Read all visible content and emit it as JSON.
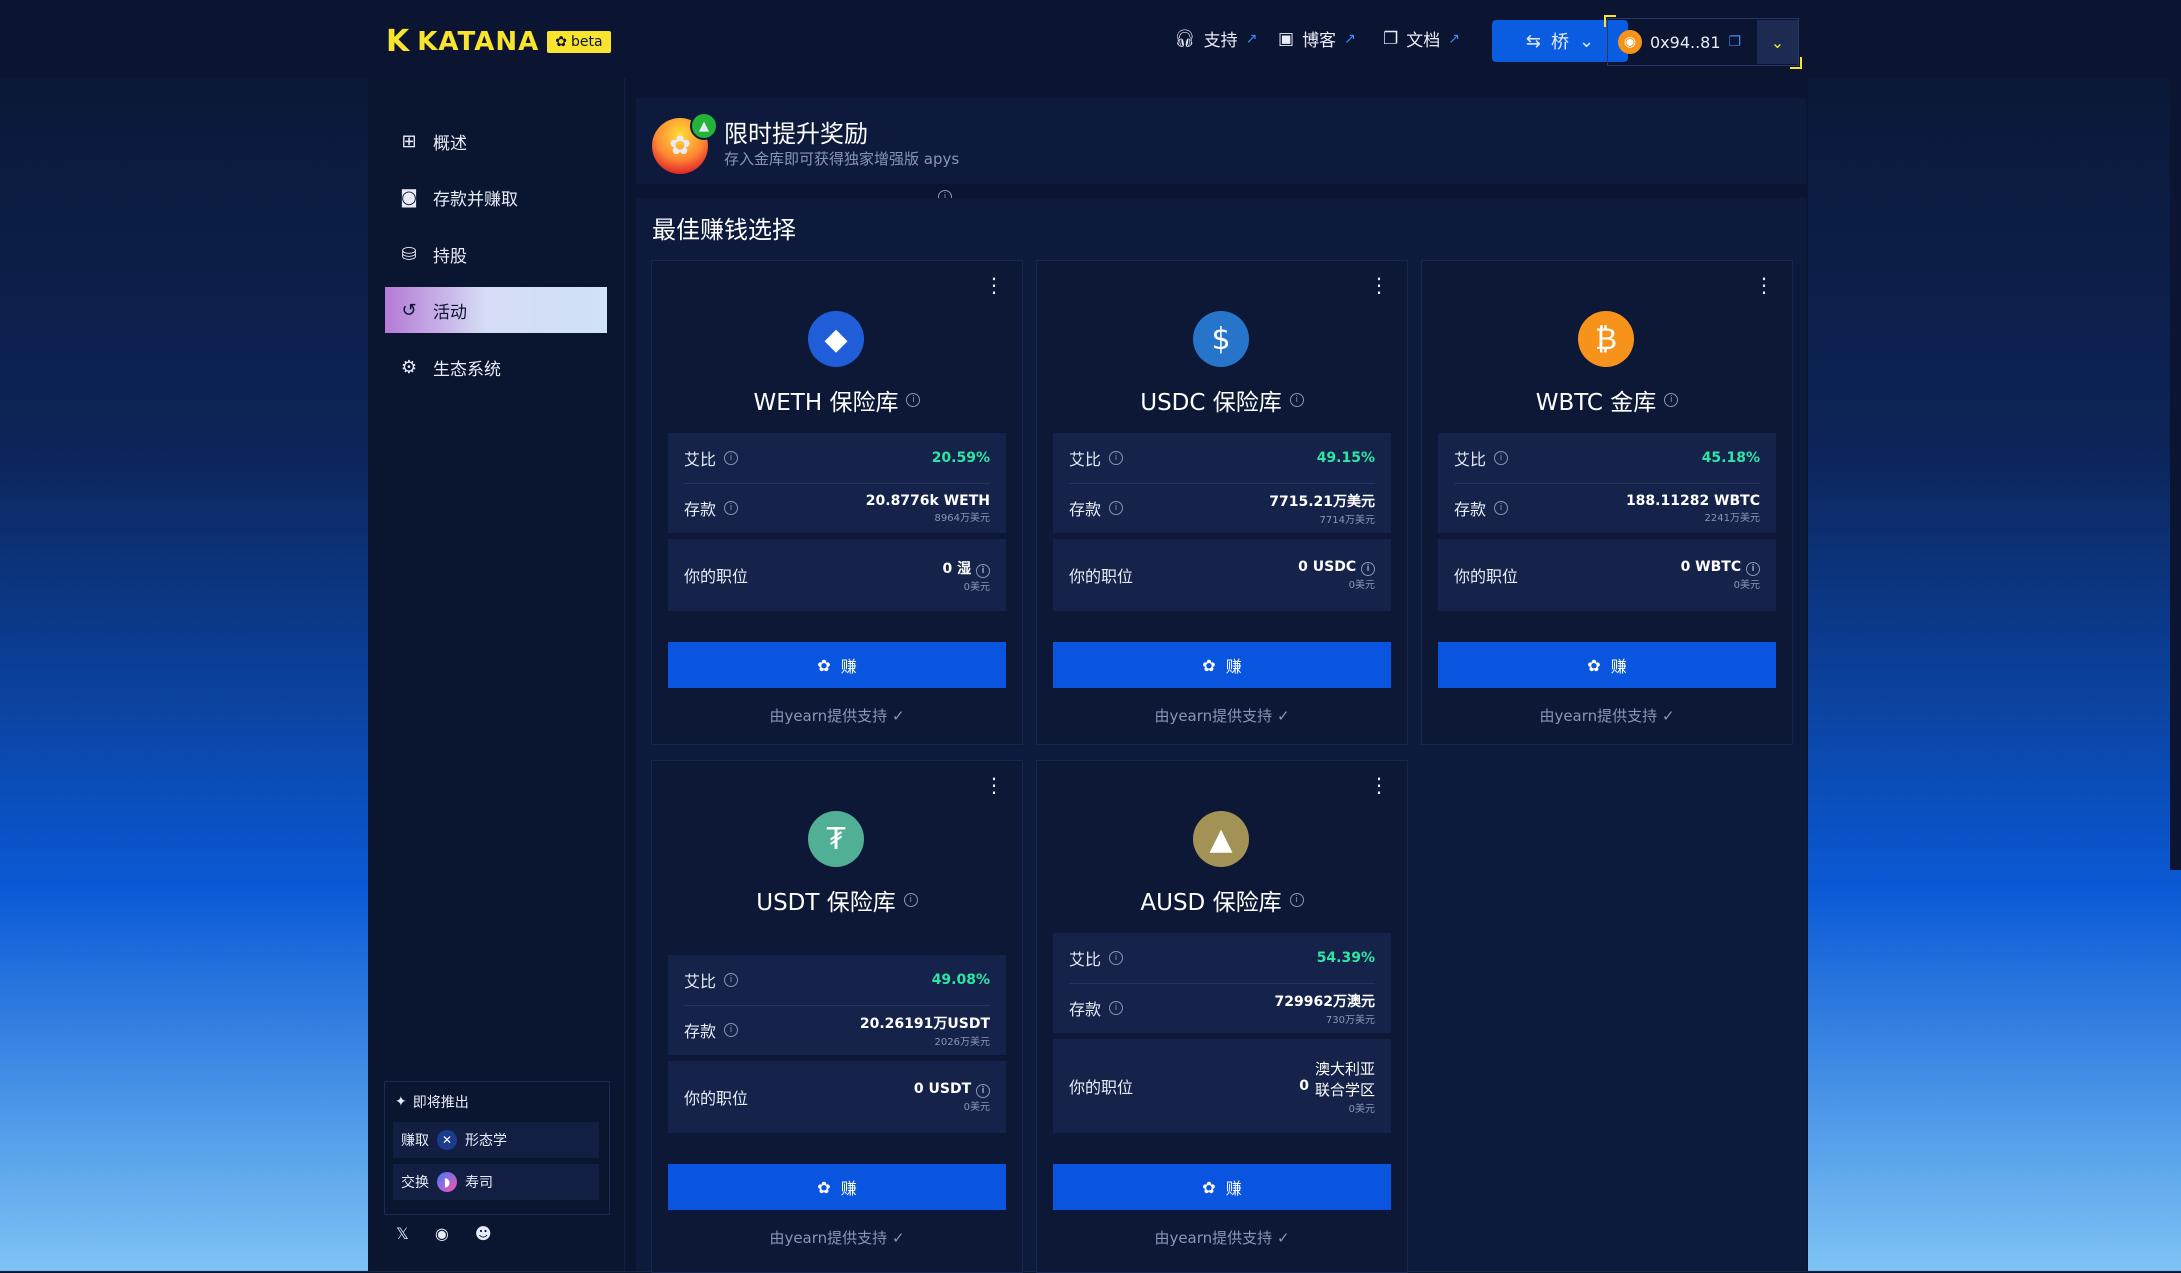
{
  "brand": {
    "name": "KATANA",
    "badge": "beta"
  },
  "topnav": {
    "support": "支持",
    "blog": "博客",
    "docs": "文档",
    "bridge": "桥",
    "wallet_address": "0x94..81"
  },
  "sidebar": {
    "items": [
      {
        "label": "概述"
      },
      {
        "label": "存款并赚取"
      },
      {
        "label": "持股"
      },
      {
        "label": "活动"
      },
      {
        "label": "生态系统"
      }
    ],
    "coming_soon": {
      "title": "即将推出",
      "rows": [
        {
          "action": "赚取",
          "name": "形态学"
        },
        {
          "action": "交换",
          "name": "寿司"
        }
      ]
    }
  },
  "banner": {
    "title": "限时提升奖励",
    "subtitle": "存入金库即可获得独家增强版 apys"
  },
  "section": {
    "title": "最佳赚钱选择"
  },
  "labels": {
    "apr": "艾比",
    "deposit": "存款",
    "position": "你的职位",
    "earn": "赚",
    "powered_by": "由yearn提供支持"
  },
  "vaults": [
    {
      "title": "WETH 保险库",
      "icon": "ethereum-icon",
      "color": "#1f5ed8",
      "apr": "20.59%",
      "deposit": "20.8776k WETH",
      "deposit_usd": "8964万美元",
      "position": "0 湿",
      "position_usd": "0美元"
    },
    {
      "title": "USDC 保险库",
      "icon": "usdc-icon",
      "color": "#2775ca",
      "apr": "49.15%",
      "deposit": "7715.21万美元",
      "deposit_usd": "7714万美元",
      "position": "0 USDC",
      "position_usd": "0美元"
    },
    {
      "title": "WBTC 金库",
      "icon": "bitcoin-icon",
      "color": "#f7931a",
      "apr": "45.18%",
      "deposit": "188.11282 WBTC",
      "deposit_usd": "2241万美元",
      "position": "0 WBTC",
      "position_usd": "0美元"
    },
    {
      "title": "USDT 保险库",
      "icon": "tether-icon",
      "color": "#50af95",
      "apr": "49.08%",
      "deposit": "20.26191万USDT",
      "deposit_usd": "2026万美元",
      "position": "0 USDT",
      "position_usd": "0美元"
    },
    {
      "title": "AUSD 保险库",
      "icon": "ausd-icon",
      "color": "#a39256",
      "apr": "54.39%",
      "deposit": "729962万澳元",
      "deposit_usd": "730万美元",
      "position": "0",
      "position_line1": "澳大利亚",
      "position_line2": "联合学区",
      "position_usd": "0美元"
    }
  ]
}
